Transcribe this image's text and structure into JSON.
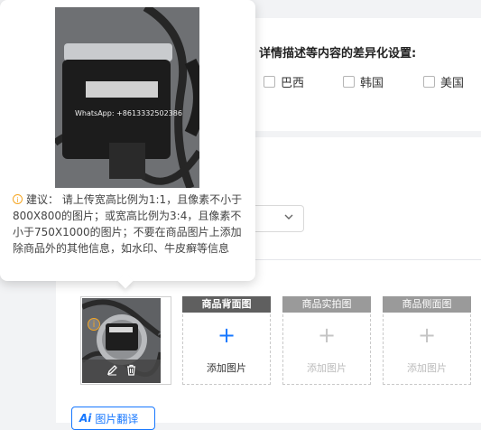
{
  "diff_settings": {
    "title": "详情描述等内容的差异化设置:",
    "countries": [
      {
        "label": "巴西",
        "checked": false
      },
      {
        "label": "韩国",
        "checked": false
      },
      {
        "label": "美国",
        "checked": false
      }
    ]
  },
  "dropdown": {
    "value": "",
    "chevron": "chevron-down-icon"
  },
  "tooltip": {
    "suggestion": "建议：  请上传宽高比例为1:1，且像素不小于800X800的图片；或宽高比例为3:4，且像素不小于750X1000的图片；不要在商品图片上添加除商品外的其他信息，如水印、牛皮癣等信息",
    "watermark": "WhatsApp: +8613332502386"
  },
  "main_image": {
    "warning_icon": "info-icon",
    "actions": [
      "edit-icon",
      "delete-icon"
    ]
  },
  "slots": [
    {
      "header": "商品背面图",
      "add_label": "添加图片",
      "enabled": true
    },
    {
      "header": "商品实拍图",
      "add_label": "添加图片",
      "enabled": false
    },
    {
      "header": "商品侧面图",
      "add_label": "添加图片",
      "enabled": false
    }
  ],
  "translate_button": {
    "icon_text": "Ai",
    "label": "图片翻译"
  },
  "colors": {
    "accent": "#1677ff",
    "warning": "#f5a623"
  }
}
